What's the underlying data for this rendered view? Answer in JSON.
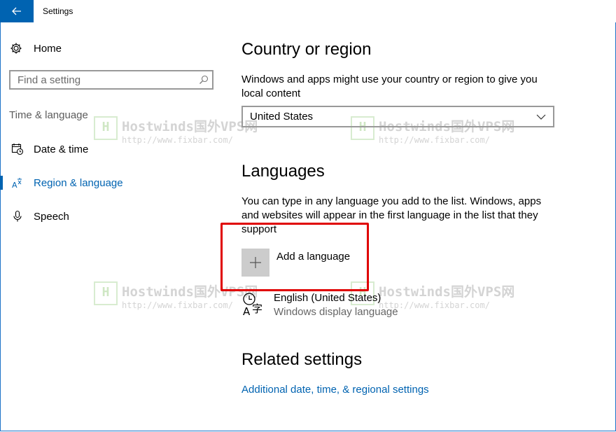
{
  "window": {
    "title": "Settings"
  },
  "sidebar": {
    "home_label": "Home",
    "search_placeholder": "Find a setting",
    "section_label": "Time & language",
    "items": [
      {
        "label": "Date & time",
        "icon": "calendar-clock-icon"
      },
      {
        "label": "Region & language",
        "icon": "region-language-icon",
        "active": true
      },
      {
        "label": "Speech",
        "icon": "microphone-icon"
      }
    ]
  },
  "main": {
    "country": {
      "heading": "Country or region",
      "description": "Windows and apps might use your country or region to give you local content",
      "selected": "United States"
    },
    "languages": {
      "heading": "Languages",
      "description": "You can type in any language you add to the list. Windows, apps and websites will appear in the first language in the list that they support",
      "add_label": "Add a language",
      "list": [
        {
          "name": "English (United States)",
          "detail": "Windows display language"
        }
      ]
    },
    "related": {
      "heading": "Related settings",
      "link": "Additional date, time, & regional settings"
    }
  },
  "watermark": {
    "text": "Hostwinds国外VPS网",
    "url": "http://www.fixbar.com/"
  },
  "colors": {
    "accent": "#0063b1",
    "highlight": "#e00000"
  }
}
